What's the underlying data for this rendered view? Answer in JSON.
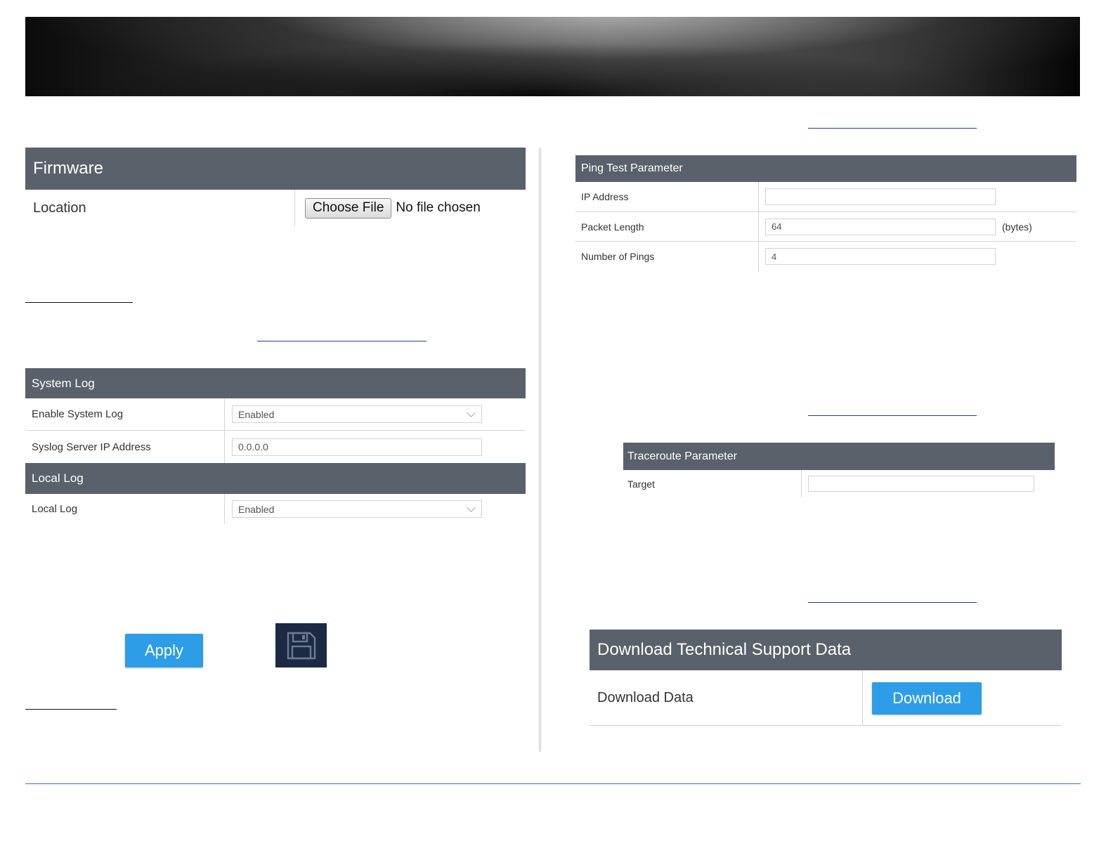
{
  "firmware": {
    "title": "Firmware",
    "location_label": "Location",
    "choose_file": "Choose File",
    "no_file": "No file chosen"
  },
  "system_log": {
    "title": "System Log",
    "enable_label": "Enable System Log",
    "enable_value": "Enabled",
    "server_label": "Syslog Server IP Address",
    "server_value": "0.0.0.0"
  },
  "local_log": {
    "title": "Local Log",
    "label": "Local Log",
    "value": "Enabled"
  },
  "apply_label": "Apply",
  "save_icon": "floppy-disk-icon",
  "ping": {
    "title": "Ping Test Parameter",
    "ip_label": "IP Address",
    "ip_value": "",
    "packet_label": "Packet Length",
    "packet_value": "64",
    "packet_unit": "(bytes)",
    "pings_label": "Number of Pings",
    "pings_value": "4"
  },
  "traceroute": {
    "title": "Traceroute Parameter",
    "target_label": "Target",
    "target_value": ""
  },
  "support": {
    "title": "Download Technical Support Data",
    "data_label": "Download Data",
    "download_label": "Download"
  },
  "colors": {
    "header_bg": "#5b616a",
    "accent": "#2e9de8",
    "save_bg": "#1c2a44"
  }
}
